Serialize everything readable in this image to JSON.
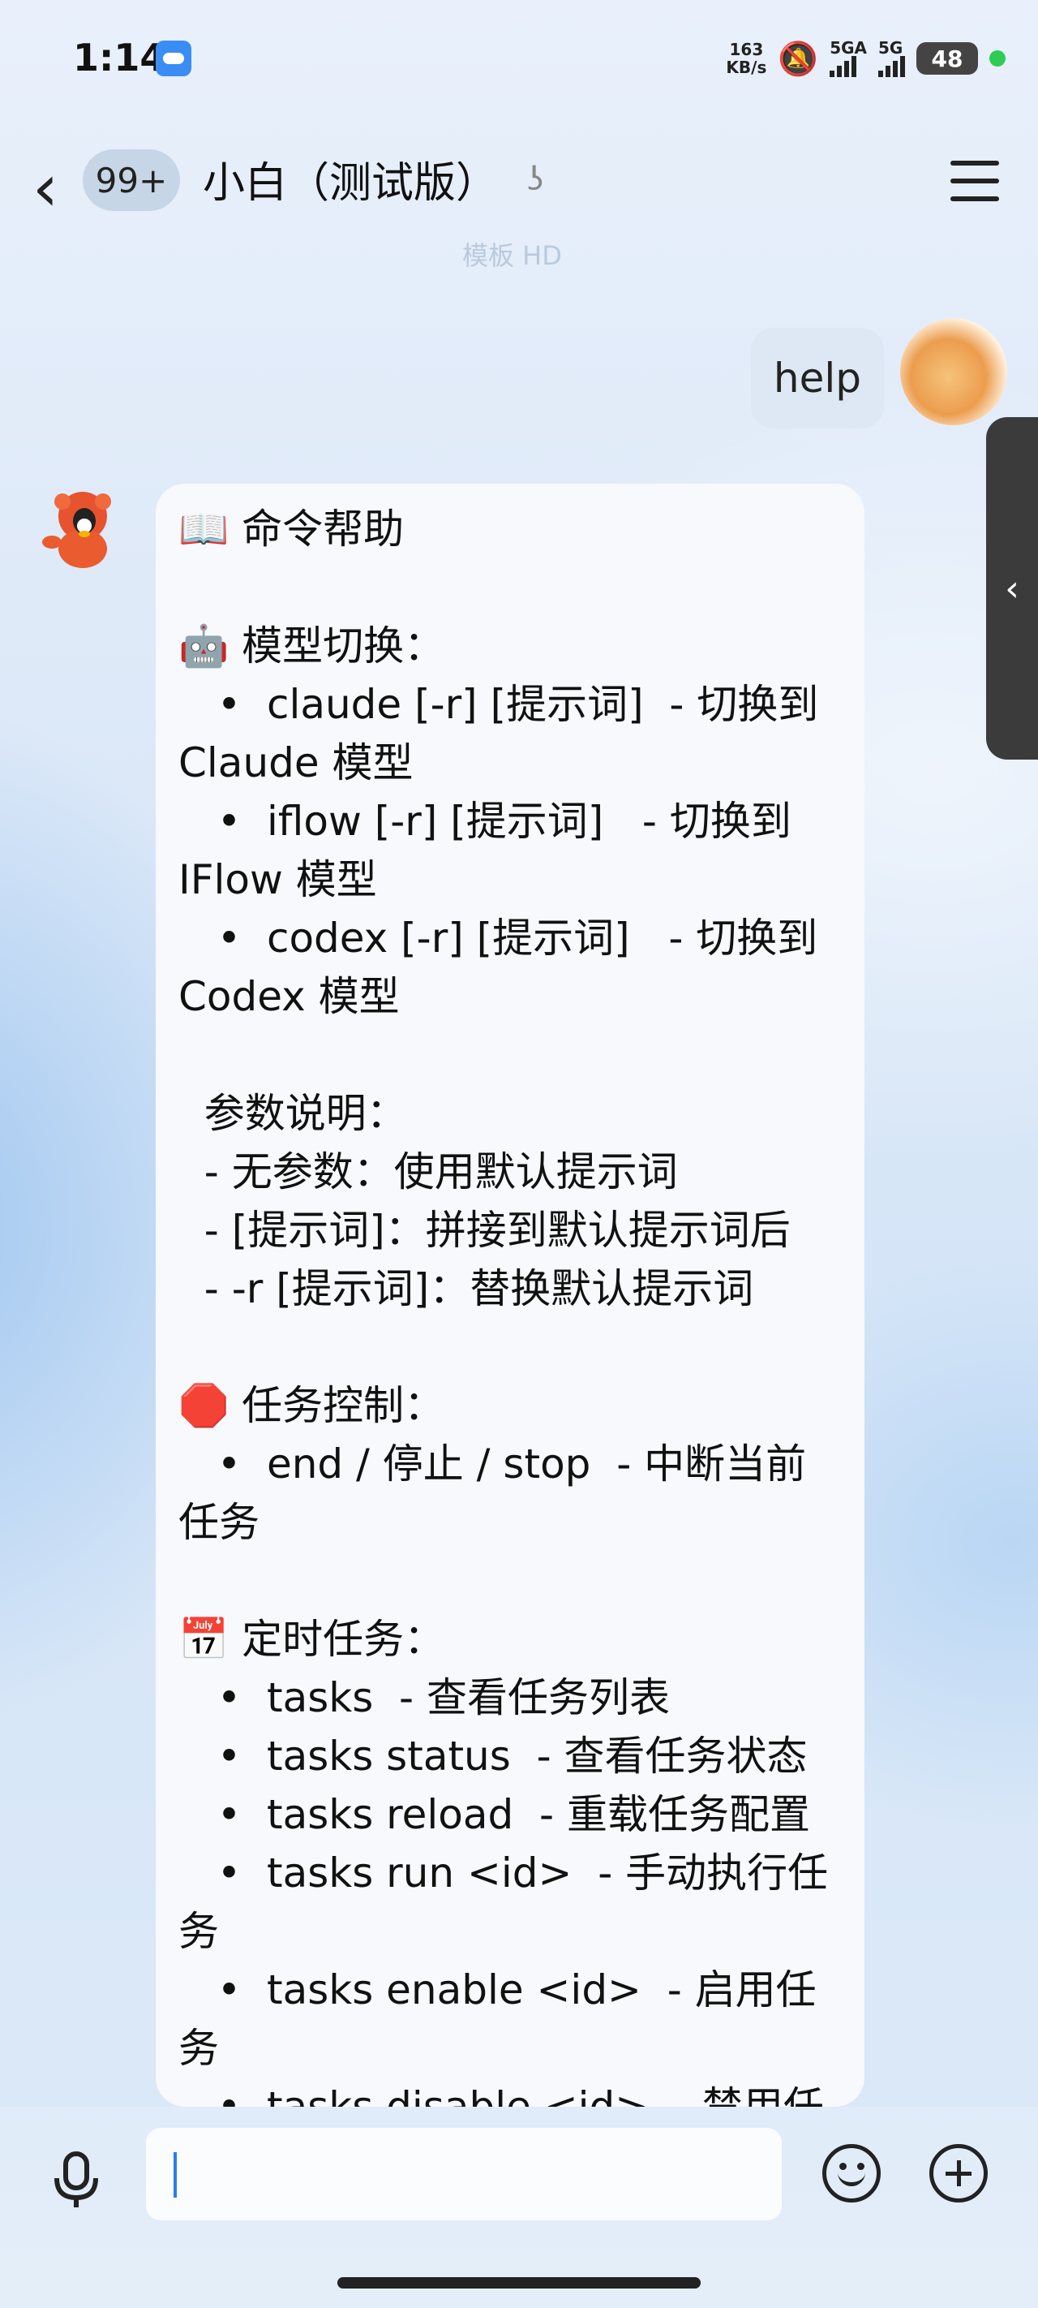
{
  "status_bar": {
    "time": "1:14",
    "net_speed_value": "163",
    "net_speed_unit": "KB/s",
    "signal1": "5GA",
    "signal2": "5G",
    "battery": "48"
  },
  "header": {
    "unread_badge": "99+",
    "title": "小白（测试版）"
  },
  "faded_text": "模板  HD",
  "messages": [
    {
      "from": "me",
      "text": "help"
    },
    {
      "from": "bot",
      "text": "📖 命令帮助\n\n🤖 模型切换：\n   •  claude [-r] [提示词]  - 切换到\nClaude 模型\n   •  iflow [-r] [提示词]   - 切换到\nIFlow 模型\n   •  codex [-r] [提示词]   - 切换到\nCodex 模型\n\n  参数说明：\n  - 无参数：使用默认提示词\n  - [提示词]：拼接到默认提示词后\n  - -r [提示词]：替换默认提示词\n\n🛑 任务控制：\n   •  end / 停止 / stop  - 中断当前\n任务\n\n📅 定时任务：\n   •  tasks  - 查看任务列表\n   •  tasks status  - 查看任务状态\n   •  tasks reload  - 重载任务配置\n   •  tasks run <id>  - 手动执行任\n务\n   •  tasks enable <id>  - 启用任\n务\n   •  tasks disable <id>  - 禁用任\n务"
    }
  ],
  "side_tab": {
    "icon": "‹"
  },
  "input": {
    "value": "",
    "placeholder": ""
  },
  "icons": {
    "back": "chevron-left-icon",
    "ear": "ear-icon",
    "menu": "hamburger-menu-icon",
    "mic": "microphone-icon",
    "emoji": "smiley-icon",
    "plus": "plus-circle-icon"
  },
  "colors": {
    "accent_caret": "#2b7de9",
    "badge_bg": "#c6d6e6",
    "bot_bubble": "#f7f9fd",
    "my_bubble": "#dde8f4"
  }
}
